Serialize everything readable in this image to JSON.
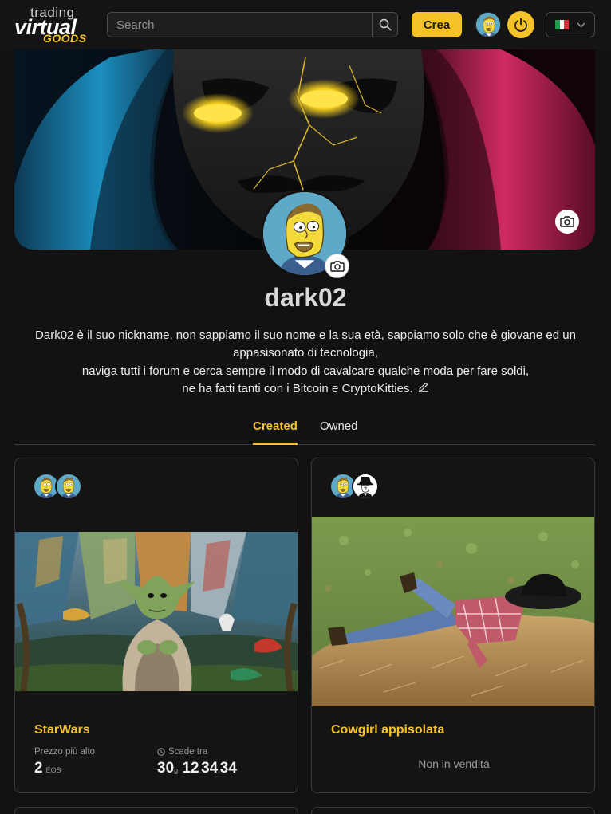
{
  "header": {
    "logo_top": "trading",
    "logo_main": "virtual",
    "logo_sub": "GOODS",
    "search_placeholder": "Search",
    "create_label": "Crea",
    "language": "it"
  },
  "profile": {
    "username": "dark02",
    "bio_lines": [
      "Dark02 è il suo nickname, non sappiamo il suo nome e la sua età, sappiamo solo che è giovane ed un appasisonato di tecnologia,",
      "naviga tutti i forum e cerca sempre il modo di cavalcare qualche moda per fare soldi,",
      "ne ha fatti tanti con i Bitcoin e CryptoKitties."
    ]
  },
  "tabs": [
    {
      "label": "Created",
      "active": true
    },
    {
      "label": "Owned",
      "active": false
    }
  ],
  "cards": [
    {
      "title": "StarWars",
      "price_label": "Prezzo più alto",
      "price_value": "2",
      "price_unit": "EOS",
      "timer_label": "Scade tra",
      "timer": {
        "days": "30",
        "day_unit": "g",
        "hours": "12",
        "minutes": "34",
        "seconds": "34"
      }
    },
    {
      "title": "Cowgirl appisolata",
      "status": "Non in vendita"
    }
  ],
  "colors": {
    "accent": "#f5c227",
    "background": "#121212",
    "card_border": "#3a3a3a"
  }
}
